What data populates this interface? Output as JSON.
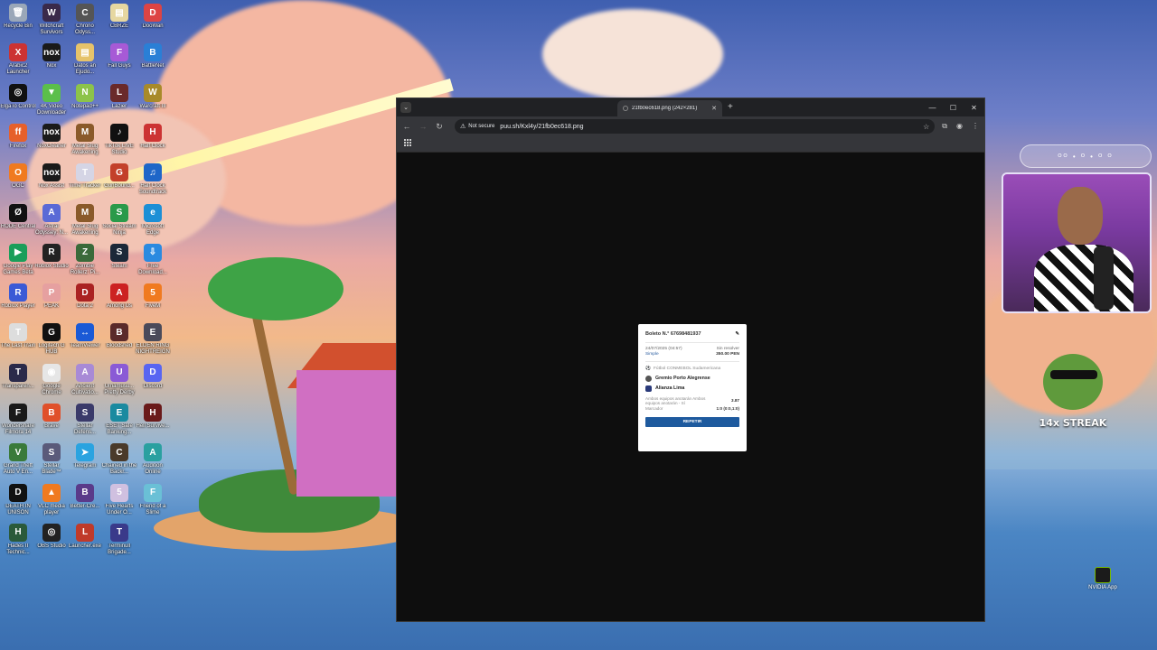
{
  "desktop_icons": [
    {
      "label": "Recycle Bin",
      "color": "#9aa7b8",
      "glyph": "🗑"
    },
    {
      "label": "Witchcraft Survivors",
      "color": "#3a2a4a",
      "glyph": "W"
    },
    {
      "label": "Chrono Odyss...",
      "color": "#555",
      "glyph": "C"
    },
    {
      "label": "CBRZE",
      "color": "#e6d7a0",
      "glyph": "▤"
    },
    {
      "label": "DooWan",
      "color": "#d44",
      "glyph": "D"
    },
    {
      "label": "Arabic2 Launcher",
      "color": "#c33",
      "glyph": "X"
    },
    {
      "label": "Nox",
      "color": "#1a1a1a",
      "glyph": "nox"
    },
    {
      "label": "Datos an Ejudo...",
      "color": "#e6c36a",
      "glyph": "▤"
    },
    {
      "label": "Fall Guys",
      "color": "#a75ad6",
      "glyph": "F"
    },
    {
      "label": "BattleNet",
      "color": "#2a7fd6",
      "glyph": "B"
    },
    {
      "label": "ElgaTo Control",
      "color": "#111",
      "glyph": "◎"
    },
    {
      "label": "4K Video Downloader",
      "color": "#5bbf4a",
      "glyph": "▼"
    },
    {
      "label": "Notepad++",
      "color": "#8cc34a",
      "glyph": "N"
    },
    {
      "label": "Lazier",
      "color": "#6a2a2a",
      "glyph": "L"
    },
    {
      "label": "Warcraft III",
      "color": "#a88a2a",
      "glyph": "W"
    },
    {
      "label": "Firefox",
      "color": "#e6602a",
      "glyph": "ff"
    },
    {
      "label": "NoxCleaner",
      "color": "#1a1a1a",
      "glyph": "nox"
    },
    {
      "label": "Metal Slug Awakening",
      "color": "#8a5a2a",
      "glyph": "M"
    },
    {
      "label": "TikTok LIVE Studio",
      "color": "#111",
      "glyph": "♪"
    },
    {
      "label": "Half Clock",
      "color": "#c33",
      "glyph": "H"
    },
    {
      "label": "OGC",
      "color": "#f07a20",
      "glyph": "O"
    },
    {
      "label": "Nox Assist",
      "color": "#1a1a1a",
      "glyph": "nox"
    },
    {
      "label": "Time Tracker",
      "color": "#d5d5e5",
      "glyph": "T"
    },
    {
      "label": "GunBound...",
      "color": "#c3402a",
      "glyph": "G"
    },
    {
      "label": "Half Clock Soundtrack",
      "color": "#1e66c8",
      "glyph": "♫"
    },
    {
      "label": "RODE Central",
      "color": "#111",
      "glyph": "Ø"
    },
    {
      "label": "Astral Odyssey: N...",
      "color": "#5a6ad6",
      "glyph": "A"
    },
    {
      "label": "Metal Slug Awakening",
      "color": "#8a5a2a",
      "glyph": "M"
    },
    {
      "label": "Social Stream Ninja",
      "color": "#2a9a4a",
      "glyph": "S"
    },
    {
      "label": "Microsoft Edge",
      "color": "#1c8fd6",
      "glyph": "e"
    },
    {
      "label": "Google Play Games Beta",
      "color": "#1a9e5a",
      "glyph": "▶"
    },
    {
      "label": "Roblox Studio",
      "color": "#222",
      "glyph": "R"
    },
    {
      "label": "Zombie Rollerz: Pi...",
      "color": "#3a6a3a",
      "glyph": "Z"
    },
    {
      "label": "Steam",
      "color": "#1b2838",
      "glyph": "S"
    },
    {
      "label": "Free Download...",
      "color": "#2a8ae0",
      "glyph": "⇩"
    },
    {
      "label": "Roblox Player",
      "color": "#3a5ad6",
      "glyph": "R"
    },
    {
      "label": "PEAK",
      "color": "#e6a0a0",
      "glyph": "P"
    },
    {
      "label": "Dota 2",
      "color": "#a22",
      "glyph": "D"
    },
    {
      "label": "Among Us",
      "color": "#c22",
      "glyph": "A"
    },
    {
      "label": "FiveM",
      "color": "#f07a20",
      "glyph": "5"
    },
    {
      "label": "The Last Train",
      "color": "#ddd",
      "glyph": "T"
    },
    {
      "label": "Logitech G HUB",
      "color": "#111",
      "glyph": "G"
    },
    {
      "label": "TeamViewer",
      "color": "#1a5ad6",
      "glyph": "↔"
    },
    {
      "label": "Bloodshed",
      "color": "#5a2a2a",
      "glyph": "B"
    },
    {
      "label": "ELDEN RING NIGHTREIGN",
      "color": "#4a4a5a",
      "glyph": "E"
    },
    {
      "label": "Transparen...",
      "color": "#2a2a4a",
      "glyph": "T"
    },
    {
      "label": "Google Chrome",
      "color": "#e6e6e6",
      "glyph": "◉"
    },
    {
      "label": "Ancient Cultivatio...",
      "color": "#a88ad6",
      "glyph": "A"
    },
    {
      "label": "Umamusu... Pretty Derby",
      "color": "#8a5ad6",
      "glyph": "U"
    },
    {
      "label": "Discord",
      "color": "#5865f2",
      "glyph": "D"
    },
    {
      "label": "Wondershare Filmora 14",
      "color": "#1a1a1a",
      "glyph": "F"
    },
    {
      "label": "Brave",
      "color": "#e0502a",
      "glyph": "B"
    },
    {
      "label": "Stellar Defens...",
      "color": "#3a3a6a",
      "glyph": "S"
    },
    {
      "label": "ESET Safe Banking...",
      "color": "#1a8aa0",
      "glyph": "E"
    },
    {
      "label": "Hell Survive...",
      "color": "#6a1a1a",
      "glyph": "H"
    },
    {
      "label": "Grand Theft Auto V En...",
      "color": "#3a7a3a",
      "glyph": "V"
    },
    {
      "label": "Stellar Blade™",
      "color": "#5a5a7a",
      "glyph": "S"
    },
    {
      "label": "Telegram",
      "color": "#2aa3e0",
      "glyph": "➤"
    },
    {
      "label": "Chained in the Backr...",
      "color": "#4a3a2a",
      "glyph": "C"
    },
    {
      "label": "Audition Online",
      "color": "#2aa0a0",
      "glyph": "A"
    },
    {
      "label": "DEATH IN UNISON",
      "color": "#111",
      "glyph": "D"
    },
    {
      "label": "VLC media player",
      "color": "#f07a20",
      "glyph": "▲"
    },
    {
      "label": "Better-Cre...",
      "color": "#5a3a8a",
      "glyph": "B"
    },
    {
      "label": "Five Hearts Under O...",
      "color": "#d0c0e0",
      "glyph": "5"
    },
    {
      "label": "Friend of a Slime",
      "color": "#6ac0d6",
      "glyph": "F"
    },
    {
      "label": "Hades II Technic...",
      "color": "#2a5a3a",
      "glyph": "H"
    },
    {
      "label": "OBS Studio",
      "color": "#222",
      "glyph": "◎"
    },
    {
      "label": "Launcher.exe",
      "color": "#c03a2a",
      "glyph": "L"
    },
    {
      "label": "Terminull Brigade...",
      "color": "#3a3a8a",
      "glyph": "T"
    }
  ],
  "browser": {
    "tab_title": "21fb0ec618.png (242×281)",
    "security_label": "Not secure",
    "url": "puu.sh/Kxl4y/21fb0ec618.png"
  },
  "ticket": {
    "title": "Boleto N.° 67698481937",
    "date": "24/07/2025 (04:57)",
    "status": "Sin resolver",
    "type": "Simple",
    "stake": "350.00 PEN",
    "league": "Fútbol CONMEBOL Sudamericana",
    "team_home": "Gremio Porto Alegrense",
    "team_away": "Alianza Lima",
    "market": "Ambos equipos anotarán Ambos equipos anotarán - Sí",
    "odd": "3.87",
    "score_label": "Marcador",
    "score_value": "1:0 (0:0,1:0)",
    "button": "REPETIR"
  },
  "overlay": {
    "streak": "14x STREAK",
    "nvidia_label": "NVIDIA App",
    "cam_deco": "ᴼᴼ • ᴼ • ᴼ ᴼ"
  }
}
